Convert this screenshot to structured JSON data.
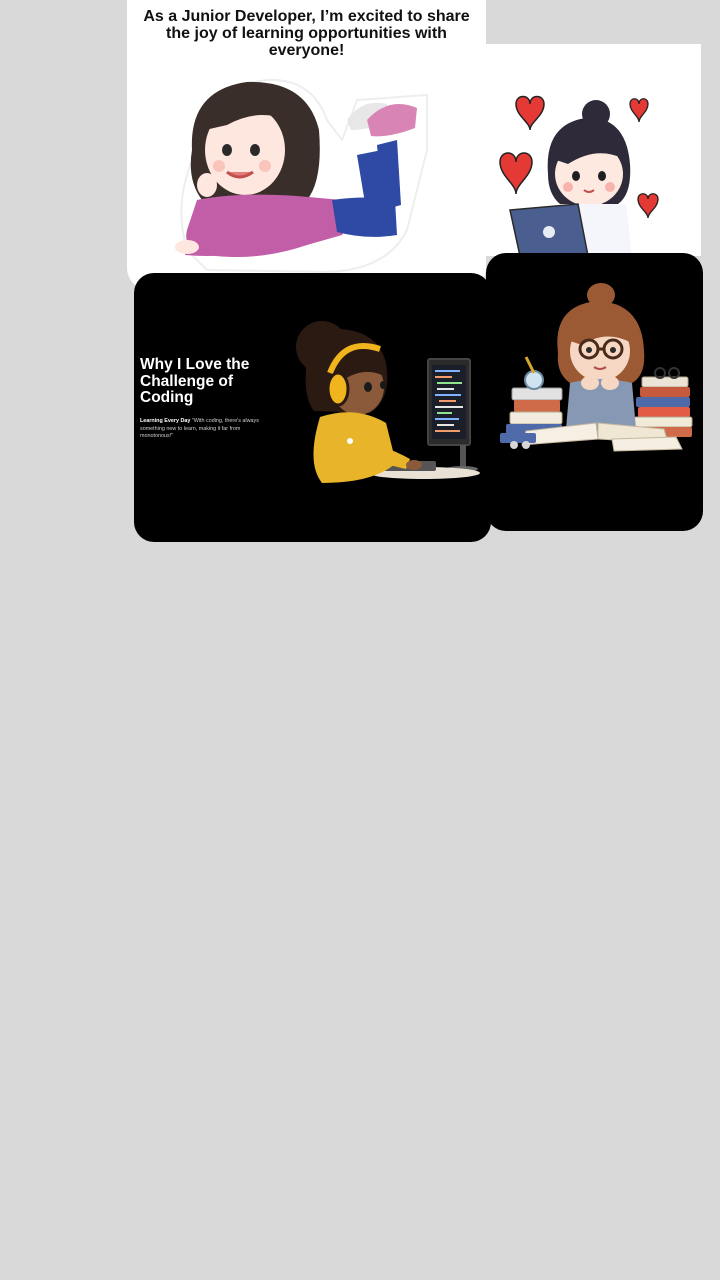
{
  "card1": {
    "headline": "As a Junior Developer, I’m excited to share the joy of learning opportunities with everyone!"
  },
  "card3": {
    "title": "Why I Love the Challenge of Coding",
    "subtitle": "Learning Every Day",
    "quote": "\"With coding, there's always something new to learn, making it far from monotonous!\""
  },
  "illustrations": {
    "card1": "girl-lying-sticker",
    "card2": "girl-with-laptop-hearts",
    "card3": "girl-coding-with-headphones",
    "card4": "girl-reading-with-books"
  }
}
